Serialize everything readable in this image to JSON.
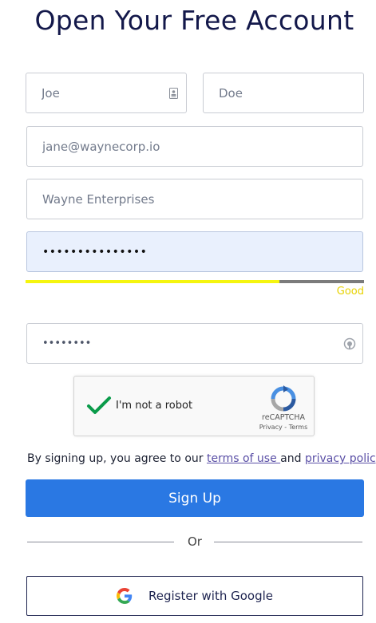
{
  "page": {
    "title": "Open Your Free Account"
  },
  "form": {
    "first_name": {
      "value": "",
      "placeholder": "Joe",
      "icon": "contact-card-icon"
    },
    "last_name": {
      "value": "",
      "placeholder": "Doe"
    },
    "email": {
      "value": "",
      "placeholder": "jane@waynecorp.io"
    },
    "company": {
      "value": "",
      "placeholder": "Wayne Enterprises"
    },
    "password": {
      "value": "•••••••••••••••"
    },
    "strength": {
      "label": "Good",
      "level": 0.75,
      "color": "#f5f50f"
    },
    "confirm_password": {
      "value": "••••••••",
      "icon": "password-reveal-icon"
    }
  },
  "captcha": {
    "checked": true,
    "label": "I'm not a robot",
    "brand": "reCAPTCHA",
    "links": "Privacy - Terms"
  },
  "terms": {
    "prefix": "By signing up, you agree to our ",
    "terms_link": "terms of use ",
    "middle": "and ",
    "privacy_link": "privacy policy"
  },
  "signup": {
    "label": "Sign Up",
    "color": "#2a78e3"
  },
  "divider": {
    "label": "Or"
  },
  "google": {
    "label": "Register with Google",
    "icon": "google-icon"
  }
}
